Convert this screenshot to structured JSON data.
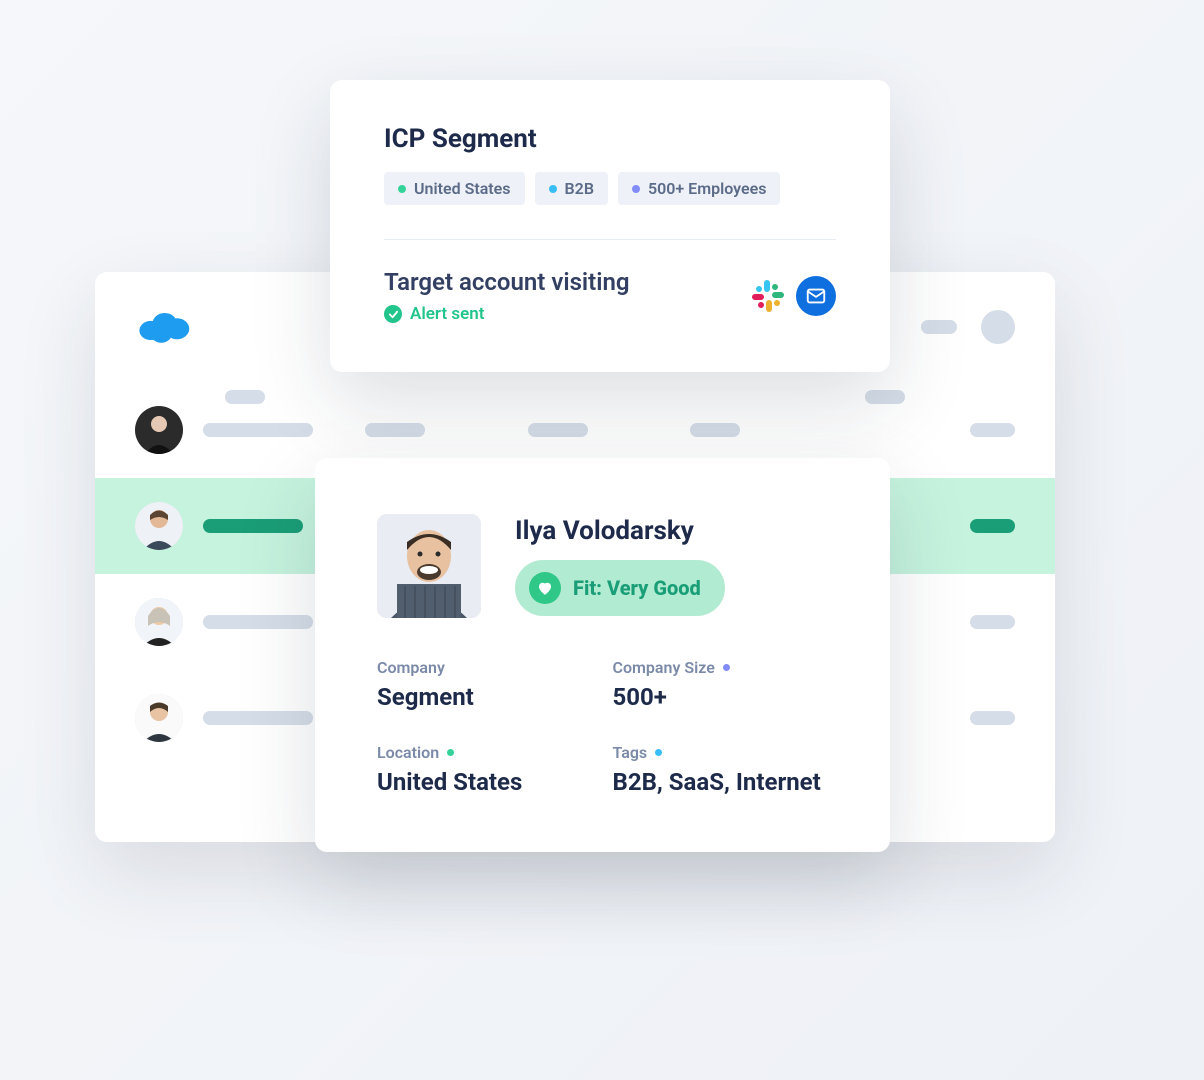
{
  "icp": {
    "title": "ICP Segment",
    "tags": [
      {
        "label": "United States",
        "dot": "green"
      },
      {
        "label": "B2B",
        "dot": "sky"
      },
      {
        "label": "500+ Employees",
        "dot": "indigo"
      }
    ],
    "target_title": "Target account visiting",
    "alert_text": "Alert sent"
  },
  "profile": {
    "name": "Ilya Volodarsky",
    "fit_prefix": "Fit:",
    "fit_value": "Very Good",
    "fit_display": "Fit: Very Good",
    "fields": {
      "company_label": "Company",
      "company_value": "Segment",
      "size_label": "Company Size",
      "size_value": "500+",
      "location_label": "Location",
      "location_value": "United States",
      "tags_label": "Tags",
      "tags_value": "B2B, SaaS, Internet"
    }
  },
  "colors": {
    "green_dot": "#34d399",
    "sky_dot": "#38bdf8",
    "indigo_dot": "#818cf8"
  }
}
